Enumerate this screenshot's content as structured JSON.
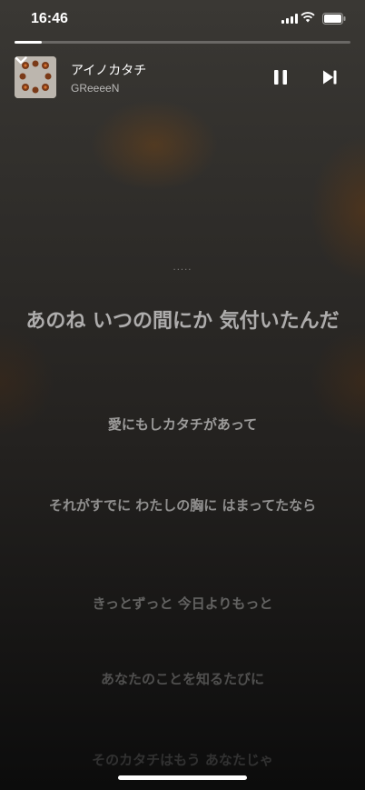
{
  "status_bar": {
    "time": "16:46"
  },
  "player": {
    "progress_fraction": 0.08,
    "title": "アイノカタチ",
    "artist": "GReeeeN"
  },
  "lyrics": {
    "countdown_dots": "·····",
    "lines": [
      "あのね いつの間にか 気付いたんだ",
      "愛にもしカタチがあって",
      "それがすでに わたしの胸に はまってたなら",
      "きっとずっと 今日よりもっと",
      "あなたのことを知るたびに",
      "そのカタチはもう あなたじゃ"
    ]
  },
  "icons": {
    "collapse": "chevron-down-icon",
    "pause": "pause-icon",
    "next": "skip-forward-icon"
  }
}
